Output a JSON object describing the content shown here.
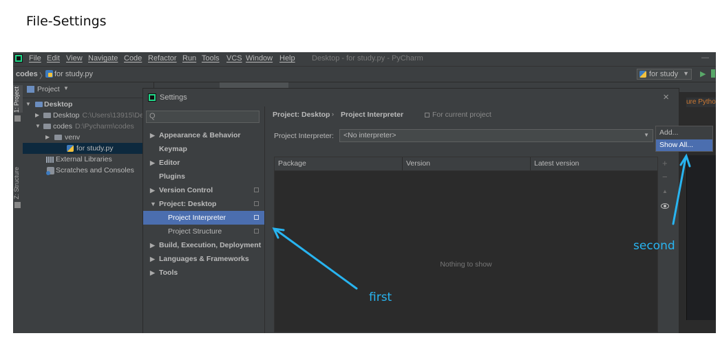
{
  "caption": "File-Settings",
  "menu": {
    "items": [
      "File",
      "Edit",
      "View",
      "Navigate",
      "Code",
      "Refactor",
      "Run",
      "Tools",
      "VCS",
      "Window",
      "Help"
    ],
    "window_title": "Desktop - for study.py - PyCharm",
    "minimize": "—"
  },
  "nav": {
    "crumb_root": "codes",
    "crumb_sep": "〉",
    "crumb_file": "for study.py",
    "run_config": "for study",
    "run_icon": "▶"
  },
  "toolstrip": {
    "project": "1: Project",
    "structure": "Z: Structure"
  },
  "project": {
    "header": "Project",
    "tree": [
      {
        "label": "Desktop",
        "dim": ""
      },
      {
        "label": "Desktop",
        "dim": "C:\\Users\\13915\\De"
      },
      {
        "label": "codes",
        "dim": "D:\\Pycharm\\codes"
      },
      {
        "label": "venv",
        "dim": ""
      },
      {
        "label": "for study.py",
        "dim": ""
      },
      {
        "label": "External Libraries",
        "dim": ""
      },
      {
        "label": "Scratches and Consoles",
        "dim": ""
      }
    ]
  },
  "editor": {
    "right_text": "ure Python"
  },
  "settings": {
    "title": "Settings",
    "close": "×",
    "search_placeholder": "",
    "nav": [
      "Appearance & Behavior",
      "Keymap",
      "Editor",
      "Plugins",
      "Version Control",
      "Project: Desktop",
      "Project Interpreter",
      "Project Structure",
      "Build, Execution, Deployment",
      "Languages & Frameworks",
      "Tools"
    ],
    "breadcrumb": {
      "project": "Project: Desktop",
      "sep": "›",
      "page": "Project Interpreter",
      "scope": "For current project"
    },
    "interpreter_label": "Project Interpreter:",
    "interpreter_value": "<No interpreter>",
    "table": {
      "columns": [
        "Package",
        "Version",
        "Latest version"
      ],
      "empty": "Nothing to show"
    },
    "tools": {
      "add": "+",
      "remove": "−",
      "up": "▲"
    }
  },
  "popup": {
    "items": [
      "Add...",
      "Show All..."
    ]
  },
  "annotations": {
    "first": "first",
    "second": "second"
  }
}
